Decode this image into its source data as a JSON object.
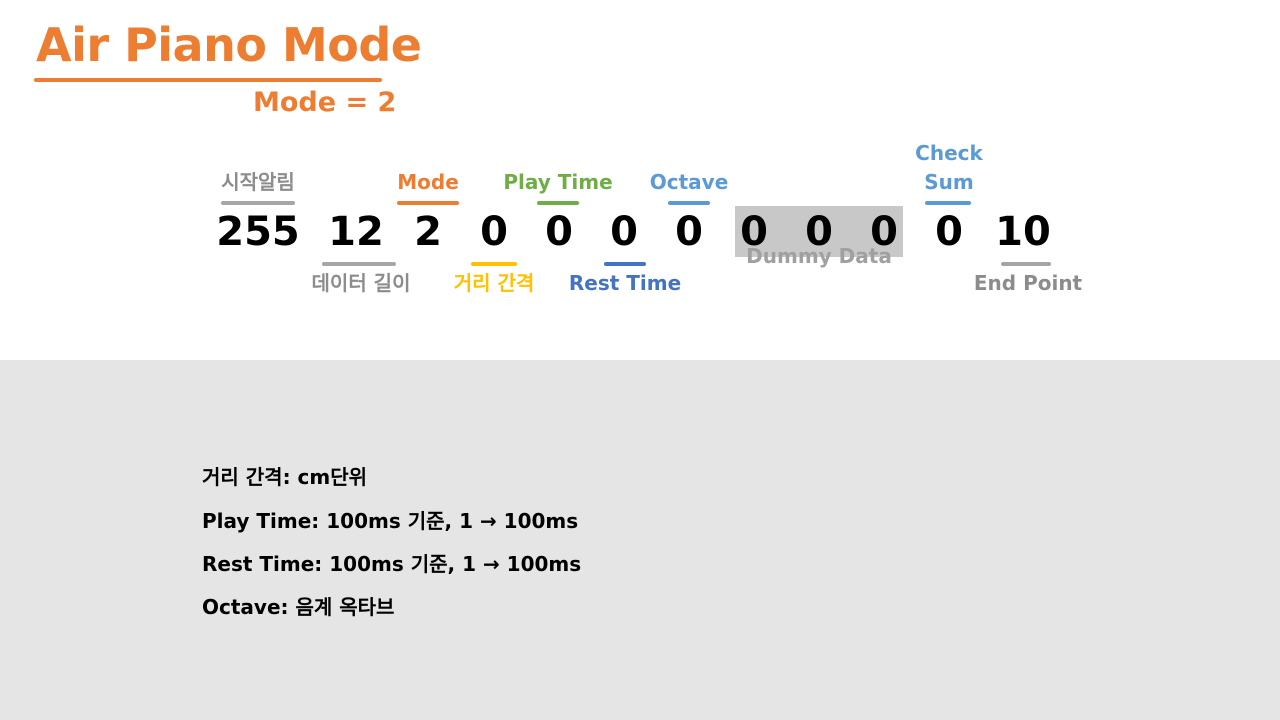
{
  "title": "Air Piano Mode",
  "subtitle": "Mode = 2",
  "packet": {
    "values": [
      "255",
      "12",
      "2",
      "0",
      "0",
      "0",
      "0",
      "0",
      "0",
      "0",
      "0",
      "10"
    ],
    "labels_top": {
      "start": "시작알림",
      "mode": "Mode",
      "play_time": "Play Time",
      "octave": "Octave",
      "checksum_line1": "Check",
      "checksum_line2": "Sum"
    },
    "labels_bottom": {
      "data_length": "데이터 길이",
      "distance": "거리 간격",
      "rest_time": "Rest Time",
      "dummy": "Dummy Data",
      "end_point": "End Point"
    }
  },
  "notes": [
    "거리 간격: cm단위",
    "Play Time: 100ms 기준, 1 → 100ms",
    "Rest Time: 100ms 기준, 1 → 100ms",
    "Octave: 음계 옥타브"
  ],
  "colors": {
    "orange": "#ED7D31",
    "green": "#70AD47",
    "blue": "#5B9BD5",
    "yellow": "#FFC000",
    "navy": "#4472C4",
    "gray": "#8C8C8C",
    "dummy_fill": "#C8C8C8",
    "panel_bg": "#E5E5E5"
  }
}
